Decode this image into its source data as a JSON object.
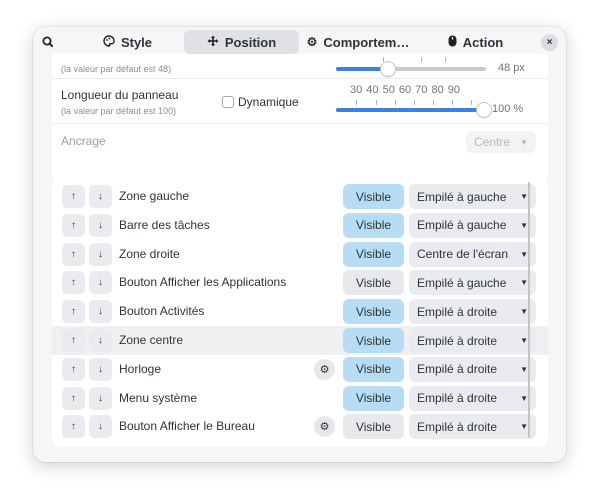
{
  "header": {
    "tabs": [
      {
        "label": "Style",
        "icon": "palette-icon"
      },
      {
        "label": "Position",
        "icon": "move-icon"
      },
      {
        "label": "Comportem…",
        "icon": "gear-icon"
      },
      {
        "label": "Action",
        "icon": "mouse-icon"
      }
    ],
    "close": "×"
  },
  "thickness": {
    "hint": "(la valeur par défaut est 48)",
    "value_text": "48 px",
    "value": 48
  },
  "length": {
    "label": "Longueur du panneau",
    "hint": "(la valeur par défaut est 100)",
    "dynamic_label": "Dynamique",
    "marks": "30 40 50 60 70 80 90",
    "value_text": "100 %",
    "value": 100
  },
  "anchor": {
    "label": "Ancrage",
    "value": "Centre"
  },
  "panel_items": [
    {
      "name": "Zone gauche",
      "visible": "Visible",
      "visible_on": true,
      "position": "Empilé à gauche",
      "gear": false
    },
    {
      "name": "Barre des tâches",
      "visible": "Visible",
      "visible_on": true,
      "position": "Empilé à gauche",
      "gear": false
    },
    {
      "name": "Zone droite",
      "visible": "Visible",
      "visible_on": true,
      "position": "Centre de l'écran",
      "gear": false
    },
    {
      "name": "Bouton Afficher les Applications",
      "visible": "Visible",
      "visible_on": false,
      "position": "Empilé à gauche",
      "gear": false
    },
    {
      "name": "Bouton Activités",
      "visible": "Visible",
      "visible_on": true,
      "position": "Empilé à droite",
      "gear": false
    },
    {
      "name": "Zone centre",
      "visible": "Visible",
      "visible_on": true,
      "position": "Empilé à droite",
      "gear": false
    },
    {
      "name": "Horloge",
      "visible": "Visible",
      "visible_on": true,
      "position": "Empilé à droite",
      "gear": true
    },
    {
      "name": "Menu système",
      "visible": "Visible",
      "visible_on": true,
      "position": "Empilé à droite",
      "gear": false
    },
    {
      "name": "Bouton Afficher le Bureau",
      "visible": "Visible",
      "visible_on": false,
      "position": "Empilé à droite",
      "gear": true
    }
  ],
  "colors": {
    "accent": "#3584e4",
    "visible_on": "#b6dcf6"
  }
}
